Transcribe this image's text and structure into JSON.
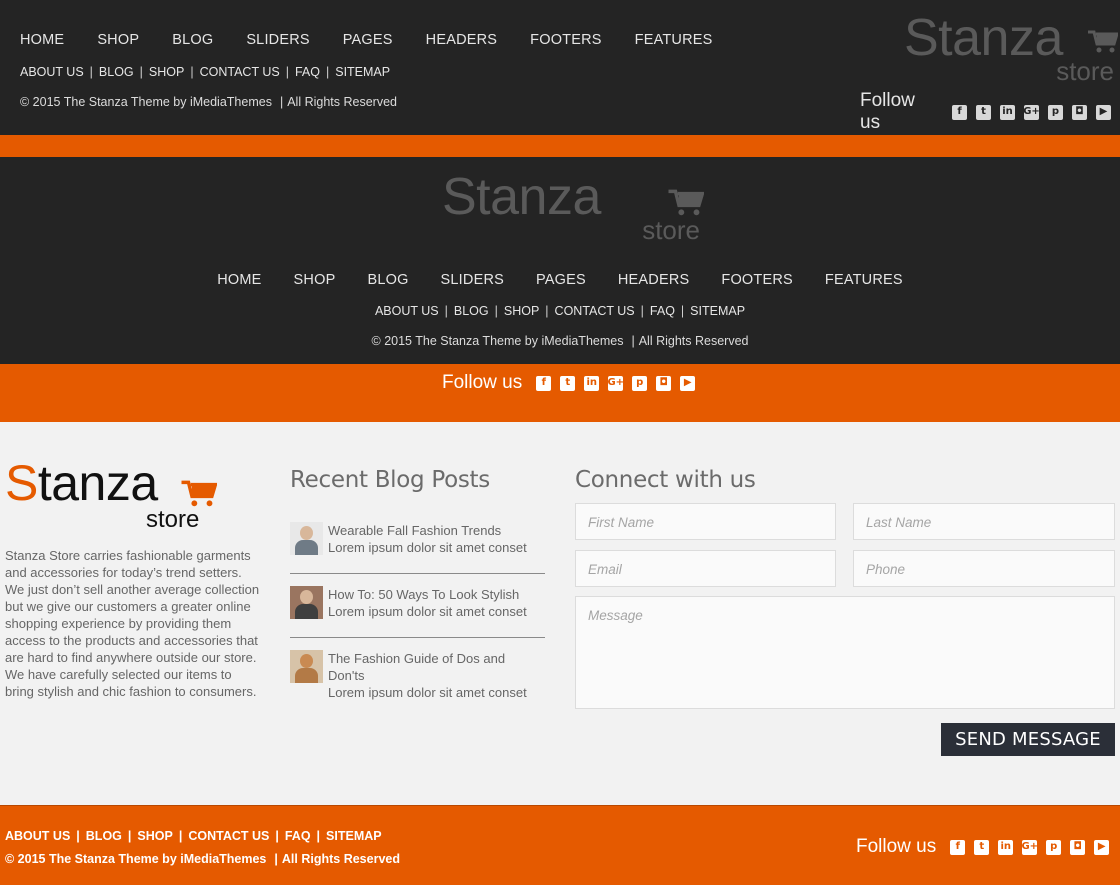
{
  "nav": {
    "main": [
      "HOME",
      "SHOP",
      "BLOG",
      "SLIDERS",
      "PAGES",
      "HEADERS",
      "FOOTERS",
      "FEATURES"
    ],
    "sub": [
      "ABOUT US",
      "BLOG",
      "SHOP",
      "CONTACT US",
      "FAQ",
      "SITEMAP"
    ]
  },
  "copyright": "© 2015 The Stanza Theme by iMediaThemes",
  "rights": "All Rights Reserved",
  "follow_label": "Follow us",
  "social_icons": [
    "facebook-icon",
    "twitter-icon",
    "linkedin-icon",
    "google-plus-icon",
    "pinterest-icon",
    "instagram-icon",
    "youtube-icon"
  ],
  "logo": {
    "stanza": "Stanza",
    "store": "store"
  },
  "about_text": "Stanza Store carries fashionable garments and accessories for today’s trend setters. We just don’t sell another average collection but we give our customers a greater online shopping experience by providing them access to the products and accessories that are hard to find anywhere outside our store. We have carefully selected our items to bring stylish and chic fashion to consumers.",
  "blog": {
    "title": "Recent Blog Posts",
    "posts": [
      {
        "title": "Wearable Fall Fashion Trends",
        "excerpt": "Lorem ipsum dolor sit amet conset"
      },
      {
        "title": "How To: 50 Ways To Look Stylish",
        "excerpt": "Lorem ipsum dolor sit amet conset"
      },
      {
        "title": "The Fashion Guide of Dos and Don'ts",
        "excerpt": "Lorem ipsum dolor sit amet conset"
      }
    ]
  },
  "connect": {
    "title": "Connect with us",
    "placeholders": {
      "first": "First Name",
      "last": "Last Name",
      "email": "Email",
      "phone": "Phone",
      "message": "Message"
    },
    "send_label": "SEND MESSAGE"
  },
  "colors": {
    "accent": "#e55a00",
    "dark": "#242424",
    "light_bg": "#f2f2f2",
    "button": "#2b2f38"
  }
}
